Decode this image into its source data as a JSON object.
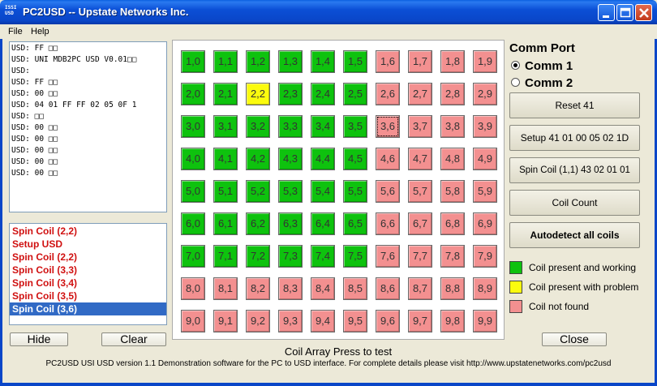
{
  "window": {
    "title": "PC2USD -- Upstate Networks Inc.",
    "icon_name": "app-icon",
    "icon_text": [
      "ISSI",
      "USD"
    ]
  },
  "menu": {
    "items": [
      "File",
      "Help"
    ]
  },
  "log": {
    "lines": [
      "USD: FF □□",
      "USD: UNI MDB2PC USD V0.01□□",
      "USD:",
      "USD: FF □□",
      "USD: 00 □□",
      "USD: 04 01 FF FF 02 05 0F 1",
      "USD: □□",
      "USD: 00 □□",
      "USD: 00 □□",
      "USD: 00 □□",
      "USD: 00 □□",
      "USD: 00 □□"
    ]
  },
  "history": {
    "items": [
      "Spin Coil (2,2)",
      "Setup USD",
      "Spin Coil (2,2)",
      "Spin Coil (3,3)",
      "Spin Coil (3,4)",
      "Spin Coil (3,5)",
      "Spin Coil (3,6)"
    ],
    "selected_index": 6
  },
  "buttons": {
    "hide": "Hide",
    "clear": "Clear",
    "close": "Close"
  },
  "grid": {
    "caption": "Coil Array Press to test",
    "rows": [
      [
        {
          "l": "1,0",
          "s": "ok"
        },
        {
          "l": "1,1",
          "s": "ok"
        },
        {
          "l": "1,2",
          "s": "ok"
        },
        {
          "l": "1,3",
          "s": "ok"
        },
        {
          "l": "1,4",
          "s": "ok"
        },
        {
          "l": "1,5",
          "s": "ok"
        },
        {
          "l": "1,6",
          "s": "miss"
        },
        {
          "l": "1,7",
          "s": "miss"
        },
        {
          "l": "1,8",
          "s": "miss"
        },
        {
          "l": "1,9",
          "s": "miss"
        }
      ],
      [
        {
          "l": "2,0",
          "s": "ok"
        },
        {
          "l": "2,1",
          "s": "ok"
        },
        {
          "l": "2,2",
          "s": "warn"
        },
        {
          "l": "2,3",
          "s": "ok"
        },
        {
          "l": "2,4",
          "s": "ok"
        },
        {
          "l": "2,5",
          "s": "ok"
        },
        {
          "l": "2,6",
          "s": "miss"
        },
        {
          "l": "2,7",
          "s": "miss"
        },
        {
          "l": "2,8",
          "s": "miss"
        },
        {
          "l": "2,9",
          "s": "miss"
        }
      ],
      [
        {
          "l": "3,0",
          "s": "ok"
        },
        {
          "l": "3,1",
          "s": "ok"
        },
        {
          "l": "3,2",
          "s": "ok"
        },
        {
          "l": "3,3",
          "s": "ok"
        },
        {
          "l": "3,4",
          "s": "ok"
        },
        {
          "l": "3,5",
          "s": "ok"
        },
        {
          "l": "3,6",
          "s": "miss",
          "focus": true
        },
        {
          "l": "3,7",
          "s": "miss"
        },
        {
          "l": "3,8",
          "s": "miss"
        },
        {
          "l": "3,9",
          "s": "miss"
        }
      ],
      [
        {
          "l": "4,0",
          "s": "ok"
        },
        {
          "l": "4,1",
          "s": "ok"
        },
        {
          "l": "4,2",
          "s": "ok"
        },
        {
          "l": "4,3",
          "s": "ok"
        },
        {
          "l": "4,4",
          "s": "ok"
        },
        {
          "l": "4,5",
          "s": "ok"
        },
        {
          "l": "4,6",
          "s": "miss"
        },
        {
          "l": "4,7",
          "s": "miss"
        },
        {
          "l": "4,8",
          "s": "miss"
        },
        {
          "l": "4,9",
          "s": "miss"
        }
      ],
      [
        {
          "l": "5,0",
          "s": "ok"
        },
        {
          "l": "5,1",
          "s": "ok"
        },
        {
          "l": "5,2",
          "s": "ok"
        },
        {
          "l": "5,3",
          "s": "ok"
        },
        {
          "l": "5,4",
          "s": "ok"
        },
        {
          "l": "5,5",
          "s": "ok"
        },
        {
          "l": "5,6",
          "s": "miss"
        },
        {
          "l": "5,7",
          "s": "miss"
        },
        {
          "l": "5,8",
          "s": "miss"
        },
        {
          "l": "5,9",
          "s": "miss"
        }
      ],
      [
        {
          "l": "6,0",
          "s": "ok"
        },
        {
          "l": "6,1",
          "s": "ok"
        },
        {
          "l": "6,2",
          "s": "ok"
        },
        {
          "l": "6,3",
          "s": "ok"
        },
        {
          "l": "6,4",
          "s": "ok"
        },
        {
          "l": "6,5",
          "s": "ok"
        },
        {
          "l": "6,6",
          "s": "miss"
        },
        {
          "l": "6,7",
          "s": "miss"
        },
        {
          "l": "6,8",
          "s": "miss"
        },
        {
          "l": "6,9",
          "s": "miss"
        }
      ],
      [
        {
          "l": "7,0",
          "s": "ok"
        },
        {
          "l": "7,1",
          "s": "ok"
        },
        {
          "l": "7,2",
          "s": "ok"
        },
        {
          "l": "7,3",
          "s": "ok"
        },
        {
          "l": "7,4",
          "s": "ok"
        },
        {
          "l": "7,5",
          "s": "ok"
        },
        {
          "l": "7,6",
          "s": "miss"
        },
        {
          "l": "7,7",
          "s": "miss"
        },
        {
          "l": "7,8",
          "s": "miss"
        },
        {
          "l": "7,9",
          "s": "miss"
        }
      ],
      [
        {
          "l": "8,0",
          "s": "miss"
        },
        {
          "l": "8,1",
          "s": "miss"
        },
        {
          "l": "8,2",
          "s": "miss"
        },
        {
          "l": "8,3",
          "s": "miss"
        },
        {
          "l": "8,4",
          "s": "miss"
        },
        {
          "l": "8,5",
          "s": "miss"
        },
        {
          "l": "8,6",
          "s": "miss"
        },
        {
          "l": "8,7",
          "s": "miss"
        },
        {
          "l": "8,8",
          "s": "miss"
        },
        {
          "l": "8,9",
          "s": "miss"
        }
      ],
      [
        {
          "l": "9,0",
          "s": "miss"
        },
        {
          "l": "9,1",
          "s": "miss"
        },
        {
          "l": "9,2",
          "s": "miss"
        },
        {
          "l": "9,3",
          "s": "miss"
        },
        {
          "l": "9,4",
          "s": "miss"
        },
        {
          "l": "9,5",
          "s": "miss"
        },
        {
          "l": "9,6",
          "s": "miss"
        },
        {
          "l": "9,7",
          "s": "miss"
        },
        {
          "l": "9,8",
          "s": "miss"
        },
        {
          "l": "9,9",
          "s": "miss"
        }
      ]
    ]
  },
  "comm": {
    "title": "Comm Port",
    "options": [
      "Comm 1",
      "Comm 2"
    ],
    "selected_index": 0
  },
  "actions": {
    "reset": "Reset 41",
    "setup": "Setup 41 01 00 05 02 1D",
    "spin": "Spin Coil (1,1) 43 02 01 01",
    "count": "Coil Count",
    "autodetect": "Autodetect all coils"
  },
  "legend": [
    {
      "label": "Coil present and working",
      "color": "#0ec20e"
    },
    {
      "label": "Coil present with problem",
      "color": "#fbfb0e"
    },
    {
      "label": "Coil not found",
      "color": "#f39090"
    }
  ],
  "footer": "PC2USD USI USD version 1.1   Demonstration software for the PC to USD interface.  For complete details please visit http://www.upstatenetworks.com/pc2usd"
}
